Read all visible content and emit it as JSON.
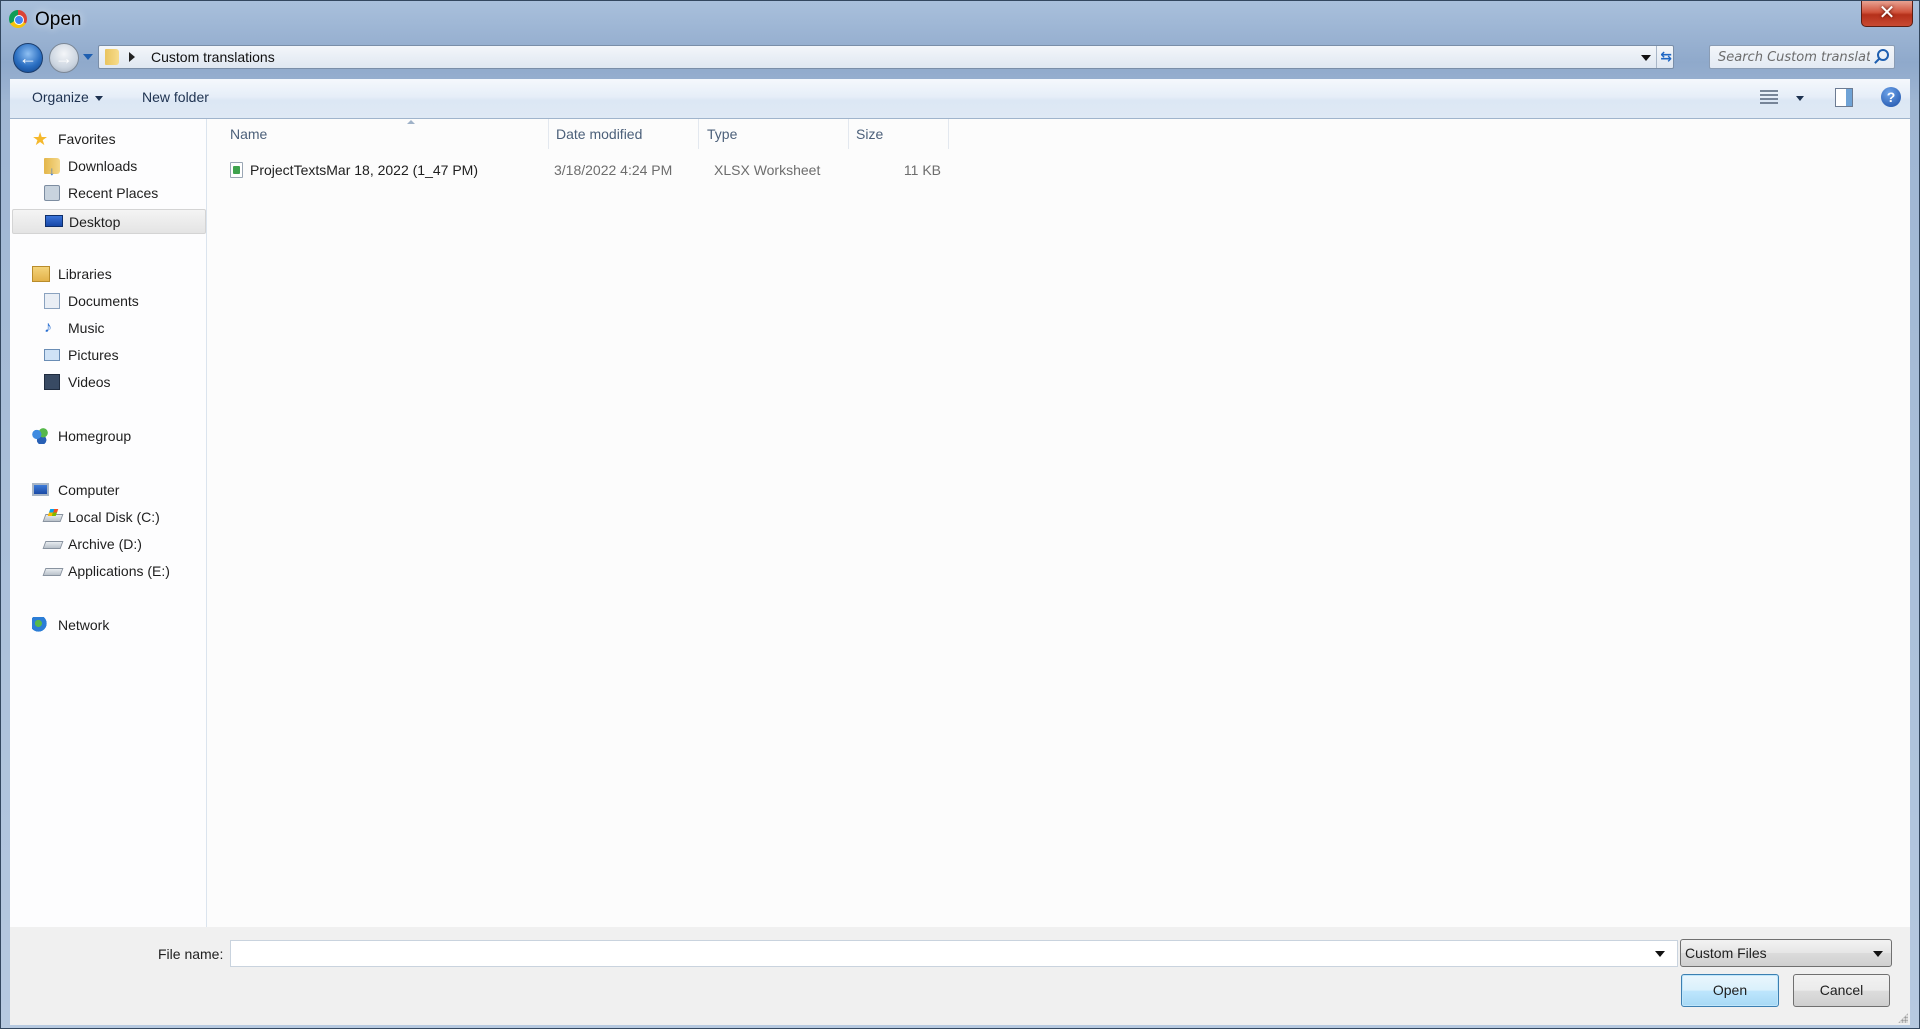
{
  "window": {
    "title": "Open",
    "close_label": "✕"
  },
  "nav": {
    "back_icon": "←",
    "forward_icon": "→",
    "breadcrumb": [
      "Custom translations"
    ],
    "refresh_icon": "⇆",
    "search_placeholder": "Search Custom translati..."
  },
  "toolbar": {
    "organize_label": "Organize",
    "new_folder_label": "New folder",
    "help_label": "?"
  },
  "sidebar": {
    "groups": [
      {
        "label": "Favorites",
        "icon": "star-icon",
        "items": [
          {
            "label": "Downloads",
            "icon": "downloads-folder-icon"
          },
          {
            "label": "Recent Places",
            "icon": "recent-places-icon"
          },
          {
            "label": "Desktop",
            "icon": "desktop-icon",
            "selected": true
          }
        ]
      },
      {
        "label": "Libraries",
        "icon": "libraries-icon",
        "items": [
          {
            "label": "Documents",
            "icon": "documents-icon"
          },
          {
            "label": "Music",
            "icon": "music-icon"
          },
          {
            "label": "Pictures",
            "icon": "pictures-icon"
          },
          {
            "label": "Videos",
            "icon": "videos-icon"
          }
        ]
      },
      {
        "label": "Homegroup",
        "icon": "homegroup-icon",
        "items": []
      },
      {
        "label": "Computer",
        "icon": "computer-icon",
        "items": [
          {
            "label": "Local Disk (C:)",
            "icon": "system-drive-icon"
          },
          {
            "label": "Archive (D:)",
            "icon": "drive-icon"
          },
          {
            "label": "Applications (E:)",
            "icon": "drive-icon"
          }
        ]
      },
      {
        "label": "Network",
        "icon": "network-icon",
        "items": []
      }
    ]
  },
  "files": {
    "columns": [
      "Name",
      "Date modified",
      "Type",
      "Size"
    ],
    "sorted_by": "Name",
    "rows": [
      {
        "name": "ProjectTextsMar 18, 2022 (1_47 PM)",
        "date_modified": "3/18/2022 4:24 PM",
        "type": "XLSX Worksheet",
        "size": "11 KB",
        "icon": "spreadsheet-file-icon"
      }
    ]
  },
  "footer": {
    "file_name_label": "File name:",
    "file_name_value": "",
    "file_type_selected": "Custom Files",
    "open_label": "Open",
    "cancel_label": "Cancel"
  }
}
